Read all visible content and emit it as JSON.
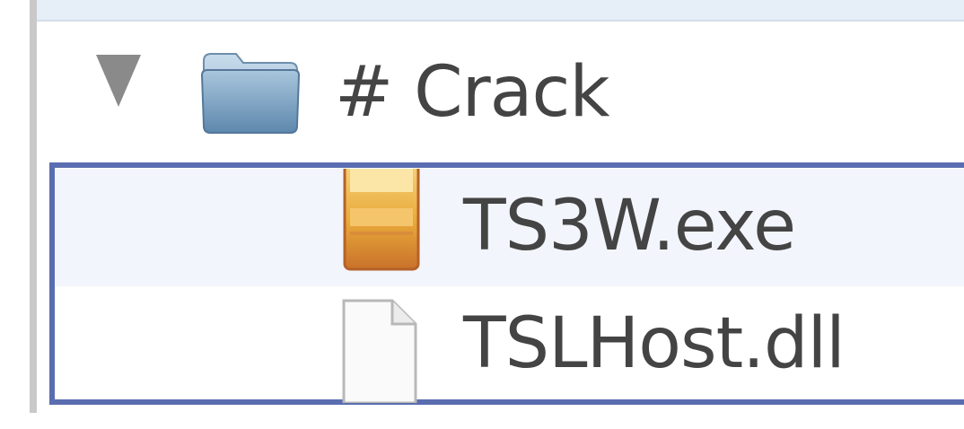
{
  "tree": {
    "folder": {
      "label": "# Crack",
      "icon": "folder-icon",
      "expanded": true
    },
    "files": [
      {
        "label": "TS3W.exe",
        "icon": "executable-icon"
      },
      {
        "label": "TSLHost.dll",
        "icon": "document-icon"
      }
    ]
  },
  "colors": {
    "selection_border": "#5a6db0",
    "header_band": "#e6eef8",
    "text": "#444444"
  }
}
